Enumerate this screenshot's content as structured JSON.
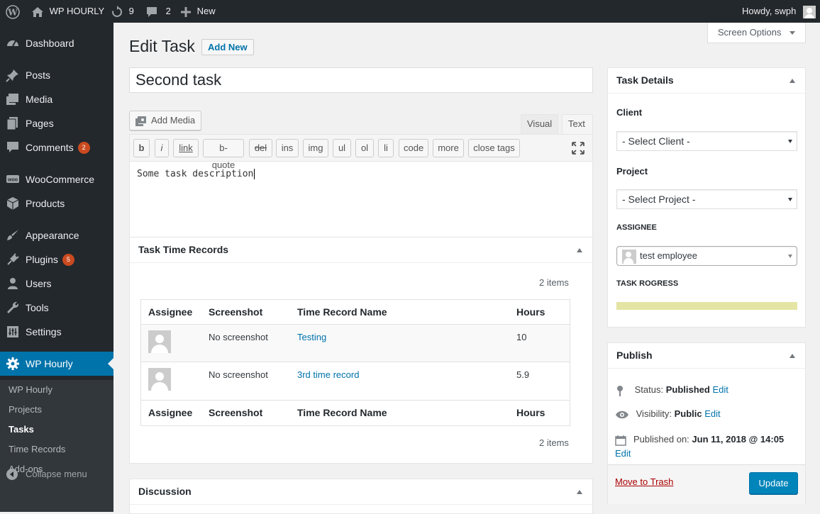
{
  "admin_bar": {
    "site_name": "WP HOURLY",
    "updates_count": "9",
    "comments_count": "2",
    "new_label": "New",
    "howdy": "Howdy, swph"
  },
  "sidebar": {
    "items": [
      {
        "label": "Dashboard",
        "icon": "dashboard-icon"
      },
      {
        "label": "Posts",
        "icon": "pin-icon"
      },
      {
        "label": "Media",
        "icon": "media-icon"
      },
      {
        "label": "Pages",
        "icon": "pages-icon"
      },
      {
        "label": "Comments",
        "icon": "comment-icon",
        "badge": "2"
      },
      {
        "label": "WooCommerce",
        "icon": "woocommerce-icon"
      },
      {
        "label": "Products",
        "icon": "box-icon"
      },
      {
        "label": "Appearance",
        "icon": "brush-icon"
      },
      {
        "label": "Plugins",
        "icon": "plug-icon",
        "badge": "5"
      },
      {
        "label": "Users",
        "icon": "user-icon"
      },
      {
        "label": "Tools",
        "icon": "wrench-icon"
      },
      {
        "label": "Settings",
        "icon": "settings-icon"
      },
      {
        "label": "WP Hourly",
        "icon": "gear-icon"
      }
    ],
    "submenu": [
      "WP Hourly",
      "Projects",
      "Tasks",
      "Time Records",
      "Add-ons"
    ],
    "collapse_label": "Collapse menu"
  },
  "screen_options": "Screen Options",
  "page": {
    "title": "Edit Task",
    "add_new": "Add New",
    "post_title": "Second task"
  },
  "editor": {
    "add_media": "Add Media",
    "tab_visual": "Visual",
    "tab_text": "Text",
    "quicktags": [
      "b",
      "i",
      "link",
      "b-quote",
      "del",
      "ins",
      "img",
      "ul",
      "ol",
      "li",
      "code",
      "more",
      "close tags"
    ],
    "content": "Some task description"
  },
  "time_records": {
    "title": "Task Time Records",
    "items_count": "2 items",
    "columns": [
      "Assignee",
      "Screenshot",
      "Time Record Name",
      "Hours"
    ],
    "rows": [
      {
        "screenshot": "No screenshot",
        "name": "Testing",
        "hours": "10"
      },
      {
        "screenshot": "No screenshot",
        "name": "3rd time record",
        "hours": "5.9"
      }
    ]
  },
  "discussion": {
    "title": "Discussion"
  },
  "task_details": {
    "title": "Task Details",
    "client_label": "Client",
    "client_value": "- Select Client -",
    "project_label": "Project",
    "project_value": "- Select Project -",
    "assignee_label": "ASSIGNEE",
    "assignee_value": "test employee",
    "progress_label": "TASK ROGRESS"
  },
  "publish": {
    "title": "Publish",
    "status_label": "Status:",
    "status_value": "Published",
    "visibility_label": "Visibility:",
    "visibility_value": "Public",
    "published_label": "Published on:",
    "published_value": "Jun 11, 2018 @ 14:05",
    "edit": "Edit",
    "move_to_trash": "Move to Trash",
    "update": "Update"
  }
}
